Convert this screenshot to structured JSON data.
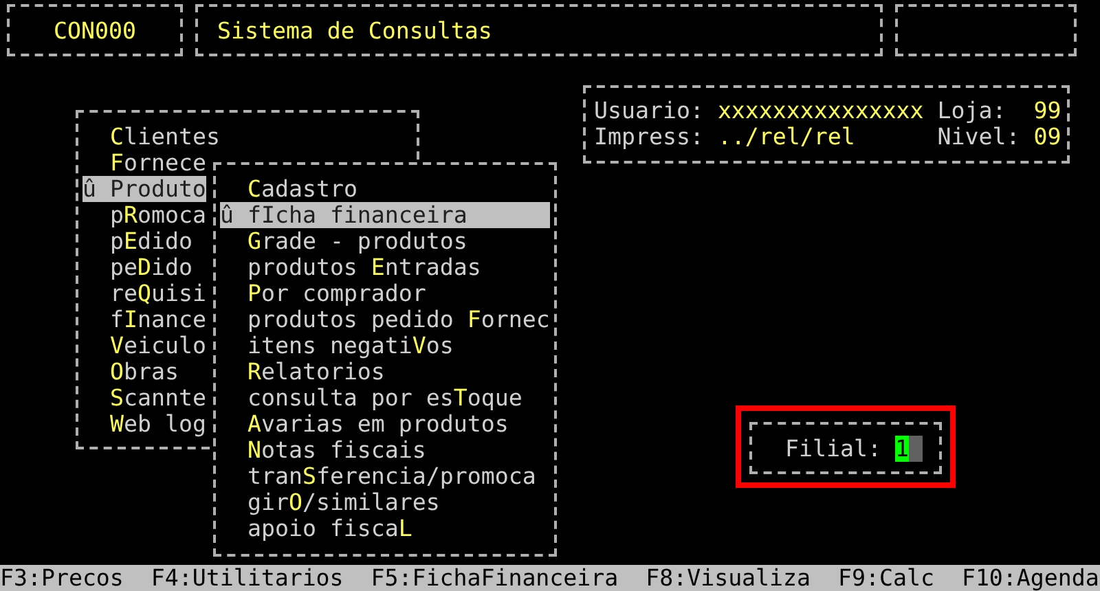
{
  "header": {
    "program_code": "CON000",
    "title": "Sistema de Consultas"
  },
  "info": {
    "user_label": "Usuario:",
    "user": "xxxxxxxxxxxxxxx",
    "store_label": "Loja:",
    "store": "99",
    "printer_label": "Impress:",
    "printer": "../rel/rel",
    "level_label": "Nivel:",
    "level_value": "09"
  },
  "main_menu": [
    {
      "key": "C",
      "post": "lientes",
      "selected": false
    },
    {
      "key": "F",
      "post": "ornece",
      "selected": false
    },
    {
      "key": "P",
      "post": "roduto",
      "selected": true,
      "marker": "û"
    },
    {
      "pre": "p",
      "key": "R",
      "post": "omoca",
      "selected": false
    },
    {
      "pre": "p",
      "key": "E",
      "post": "dido",
      "selected": false
    },
    {
      "pre": "pe",
      "key": "D",
      "post": "ido",
      "selected": false
    },
    {
      "pre": "re",
      "key": "Q",
      "post": "uisi",
      "selected": false
    },
    {
      "pre": "f",
      "key": "I",
      "post": "nance",
      "selected": false
    },
    {
      "key": "V",
      "post": "eiculo",
      "selected": false
    },
    {
      "key": "O",
      "post": "bras",
      "selected": false
    },
    {
      "key": "S",
      "post": "cannte",
      "selected": false
    },
    {
      "key": "W",
      "post": "eb log",
      "selected": false
    }
  ],
  "submenu": [
    {
      "key": "C",
      "post": "adastro",
      "selected": false
    },
    {
      "pre": "f",
      "key": "I",
      "post": "cha financeira",
      "selected": true,
      "marker": "û"
    },
    {
      "key": "G",
      "post": "rade - produtos",
      "selected": false
    },
    {
      "pre": "produtos ",
      "key": "E",
      "post": "ntradas",
      "selected": false
    },
    {
      "key": "P",
      "post": "or comprador",
      "selected": false
    },
    {
      "pre": "produtos pedido ",
      "key": "F",
      "post": "ornec",
      "selected": false
    },
    {
      "pre": "itens negati",
      "key": "V",
      "post": "os",
      "selected": false
    },
    {
      "key": "R",
      "post": "elatorios",
      "selected": false
    },
    {
      "pre": "consulta por es",
      "key": "T",
      "post": "oque",
      "selected": false
    },
    {
      "key": "A",
      "post": "varias em produtos",
      "selected": false
    },
    {
      "key": "N",
      "post": "otas fiscais",
      "selected": false
    },
    {
      "pre": "tran",
      "key": "S",
      "post": "ferencia/promoca",
      "selected": false
    },
    {
      "pre": "gir",
      "key": "O",
      "post": "/similares",
      "selected": false
    },
    {
      "pre": "apoio fisca",
      "key": "L",
      "selected": false
    }
  ],
  "branch_prompt": {
    "label": "Filial:",
    "value": "1"
  },
  "function_keys": [
    "F3:Precos",
    "F4:Utilitarios",
    "F5:FichaFinanceira",
    "F8:Visualiza",
    "F9:Calc",
    "F10:Agenda"
  ]
}
